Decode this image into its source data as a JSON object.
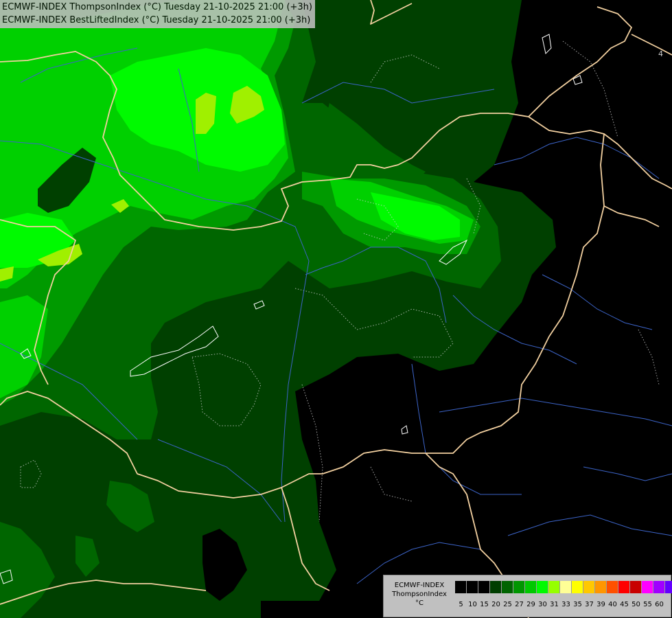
{
  "title": {
    "line1": "ECMWF-INDEX ThompsonIndex (°C) Tuesday 21-10-2025 21:00 (+3h)",
    "line2": "ECMWF-INDEX BestLiftedIndex (°C) Tuesday 21-10-2025 21:00 (+3h)"
  },
  "legend": {
    "model": "ECMWF-INDEX",
    "parameter": "ThompsonIndex",
    "unit": "°C",
    "ticks": [
      "5",
      "10",
      "15",
      "20",
      "25",
      "27",
      "29",
      "30",
      "31",
      "33",
      "35",
      "37",
      "39",
      "40",
      "45",
      "50",
      "55",
      "60"
    ],
    "colors": [
      "#000000",
      "#000000",
      "#000000",
      "#003e00",
      "#006400",
      "#009600",
      "#00c800",
      "#00fa00",
      "#96ff00",
      "#ffff96",
      "#ffff00",
      "#ffc800",
      "#ff9600",
      "#ff5000",
      "#ff0000",
      "#c80000",
      "#ff00ff",
      "#a000ff",
      "#6400ff",
      "#0000ff"
    ]
  },
  "map": {
    "fill_colors": {
      "background": "#000000",
      "level_20": "#004000",
      "level_25": "#006600",
      "level_27": "#009a00",
      "level_29": "#00d000",
      "level_30": "#00fa00",
      "level_31": "#a0f000"
    },
    "border_color": "#f2d0a0",
    "river_color": "#3c64c8",
    "contour_color": "#cfcfcf",
    "stray_label": "4"
  }
}
